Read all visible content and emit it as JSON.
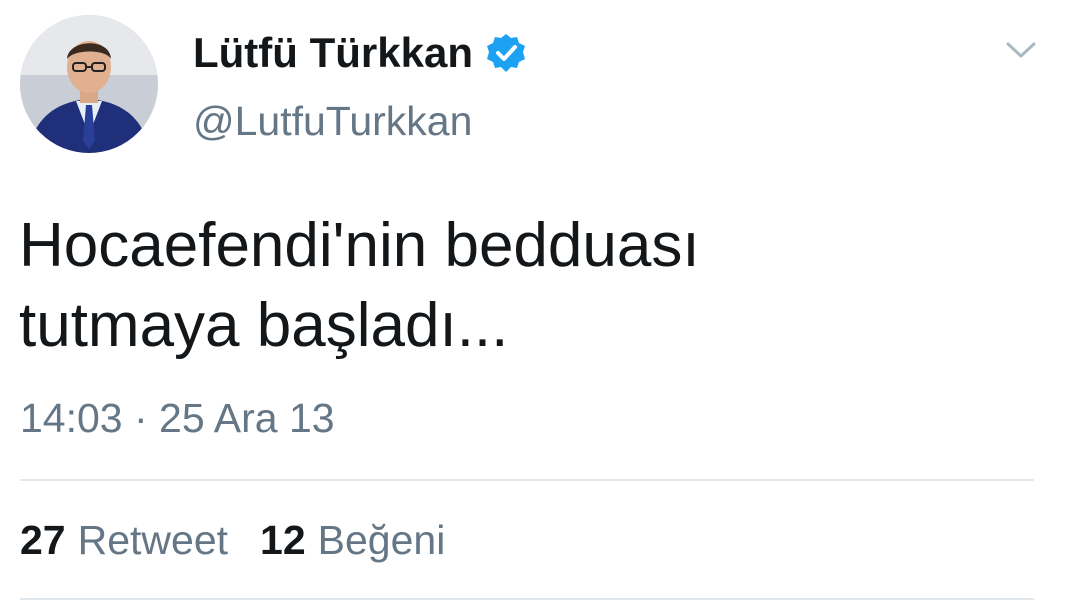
{
  "tweet": {
    "author": {
      "display_name": "Lütfü Türkkan",
      "handle": "@LutfuTurkkan",
      "verified": true,
      "avatar_icon": "profile-photo"
    },
    "text_lines": [
      "Hocaefendi'nin bedduası",
      "tutmaya başladı..."
    ],
    "timestamp": "14:03 · 25 Ara 13",
    "stats": {
      "retweet_count": "27",
      "retweet_label": "Retweet",
      "like_count": "12",
      "like_label": "Beğeni"
    },
    "menu_icon": "chevron-down-icon"
  },
  "colors": {
    "primary_text": "#14171a",
    "secondary_text": "#657786",
    "verified_blue": "#1da1f2",
    "divider": "#e1e8ed"
  }
}
